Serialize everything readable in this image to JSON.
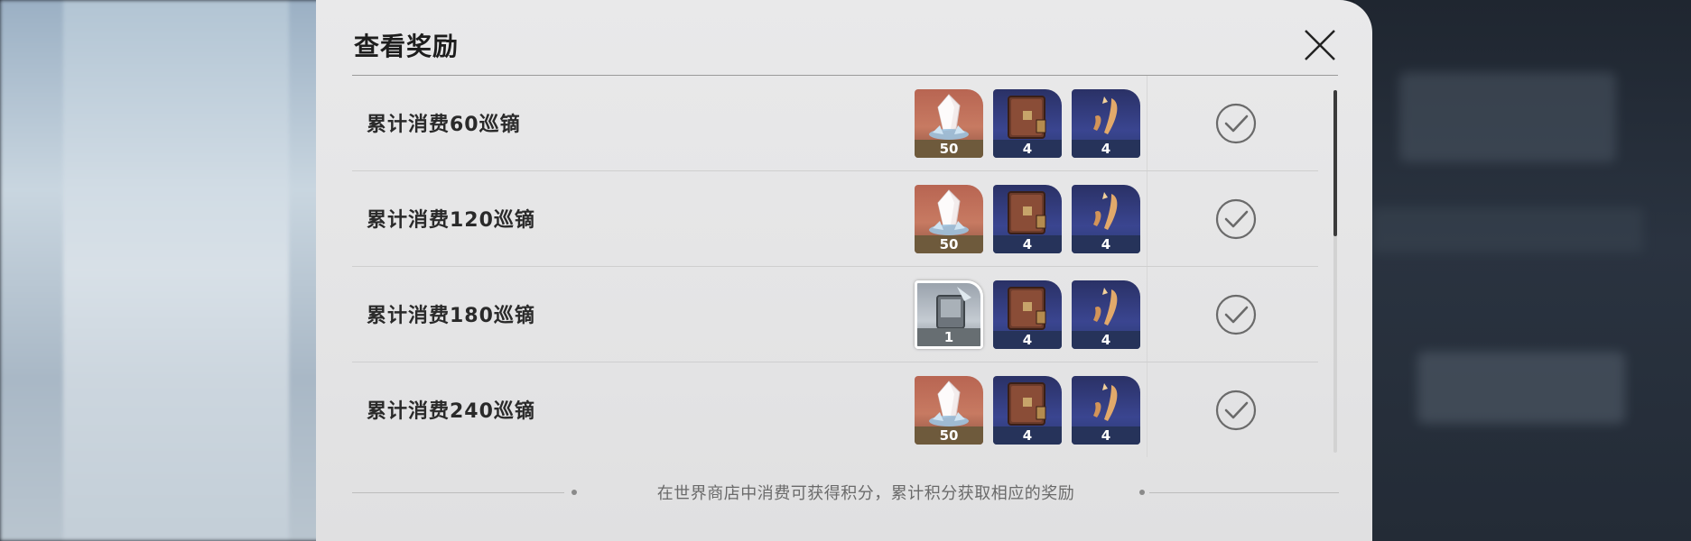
{
  "dialog": {
    "title": "查看奖励",
    "close_icon": "close-icon"
  },
  "rewards": [
    {
      "label": "累计消费60巡镝",
      "items": [
        {
          "icon": "crystal-icon",
          "count": "50",
          "rarity": "gold"
        },
        {
          "icon": "book-icon",
          "count": "4",
          "rarity": "blue"
        },
        {
          "icon": "feather-icon",
          "count": "4",
          "rarity": "blue"
        }
      ],
      "status_icon": "check-circle-icon"
    },
    {
      "label": "累计消费120巡镝",
      "items": [
        {
          "icon": "crystal-icon",
          "count": "50",
          "rarity": "gold"
        },
        {
          "icon": "book-icon",
          "count": "4",
          "rarity": "blue"
        },
        {
          "icon": "feather-icon",
          "count": "4",
          "rarity": "blue"
        }
      ],
      "status_icon": "check-circle-icon"
    },
    {
      "label": "累计消费180巡镝",
      "items": [
        {
          "icon": "chip-icon",
          "count": "1",
          "rarity": "silver"
        },
        {
          "icon": "book-icon",
          "count": "4",
          "rarity": "blue"
        },
        {
          "icon": "feather-icon",
          "count": "4",
          "rarity": "blue"
        }
      ],
      "status_icon": "check-circle-icon"
    },
    {
      "label": "累计消费240巡镝",
      "items": [
        {
          "icon": "crystal-icon",
          "count": "50",
          "rarity": "gold"
        },
        {
          "icon": "book-icon",
          "count": "4",
          "rarity": "blue"
        },
        {
          "icon": "feather-icon",
          "count": "4",
          "rarity": "blue"
        }
      ],
      "status_icon": "check-circle-icon"
    }
  ],
  "footer": {
    "hint": "在世界商店中消费可获得积分，累计积分获取相应的奖励"
  }
}
